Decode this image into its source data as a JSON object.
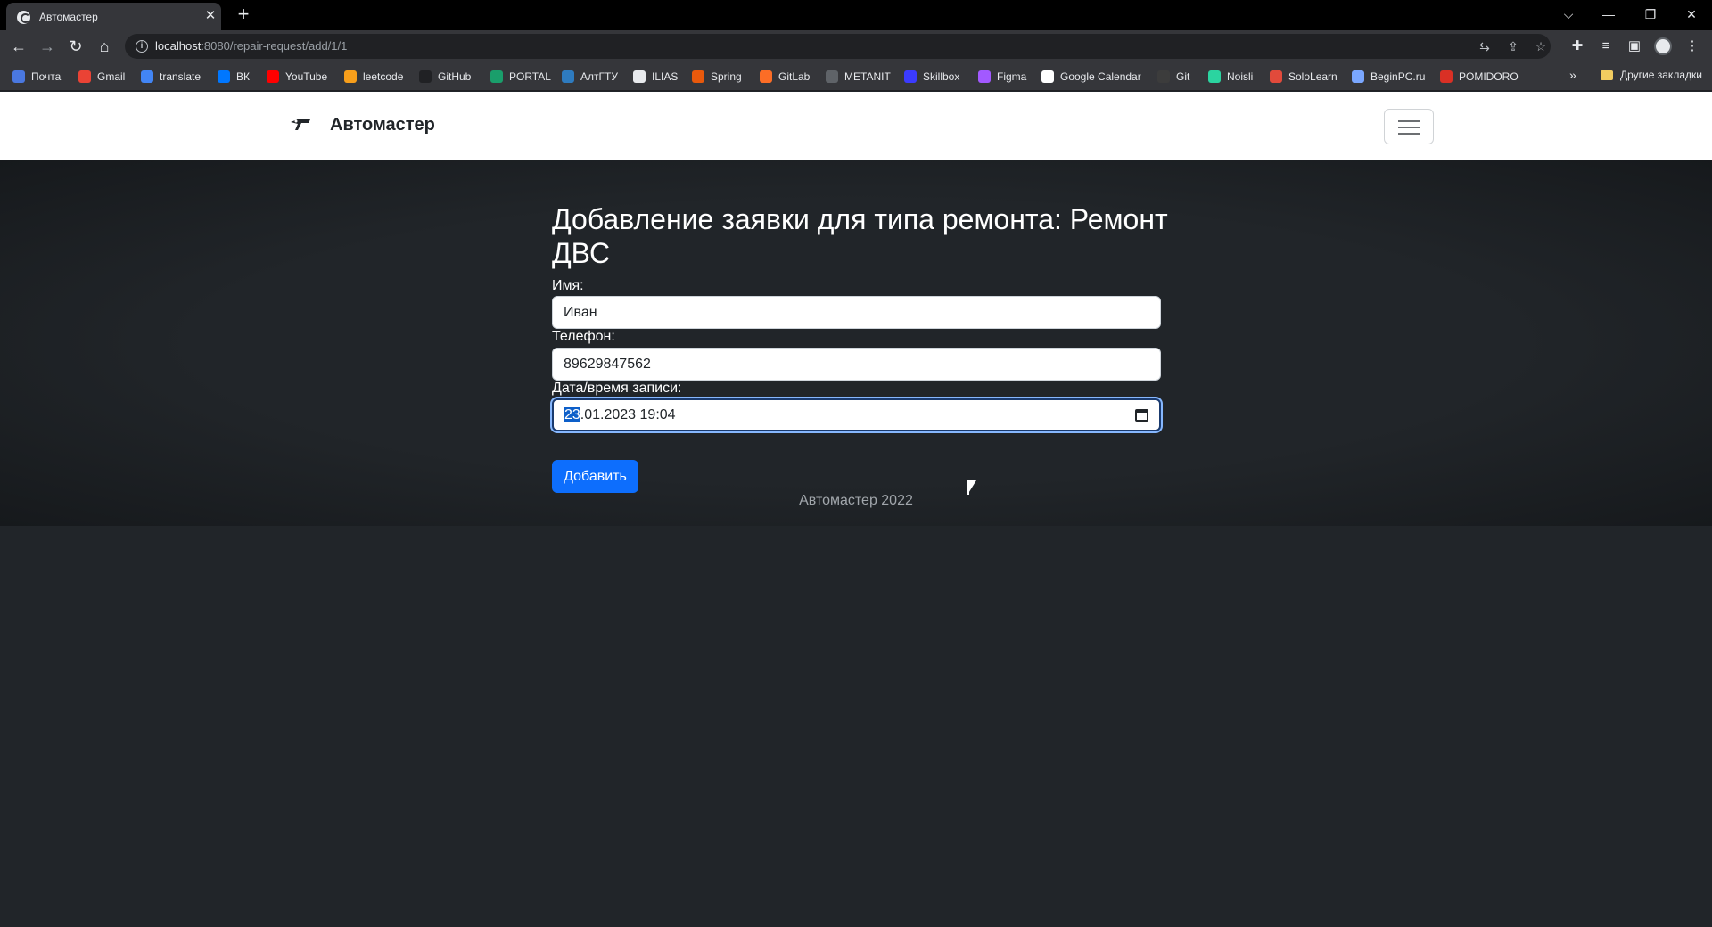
{
  "browser": {
    "tab_title": "Автомастер",
    "tab_close": "✕",
    "new_tab": "+",
    "url_host": "localhost",
    "url_path": ":8080/repair-request/add/1/1",
    "window_controls": {
      "chevron": "⌵",
      "minimize": "—",
      "restore": "❐",
      "close": "✕"
    },
    "nav": {
      "back": "←",
      "forward": "→",
      "reload": "↻",
      "home": "⌂"
    },
    "omnibox_icons": [
      "translate-icon",
      "share-icon",
      "star-icon"
    ],
    "toolbar_icons": [
      "extensions-icon",
      "media-icon",
      "sidebar-icon",
      "profile-avatar",
      "menu-icon"
    ]
  },
  "bookmarks": {
    "items": [
      {
        "label": "Почта",
        "icon": "mail-icon",
        "color": "#4a78e0"
      },
      {
        "label": "Gmail",
        "icon": "gmail-icon",
        "color": "#ea4335"
      },
      {
        "label": "translate",
        "icon": "translate-icon",
        "color": "#4285f4"
      },
      {
        "label": "ВК",
        "icon": "vk-icon",
        "color": "#0077ff"
      },
      {
        "label": "YouTube",
        "icon": "youtube-icon",
        "color": "#ff0000"
      },
      {
        "label": "leetcode",
        "icon": "leetcode-icon",
        "color": "#f89f1b"
      },
      {
        "label": "GitHub",
        "icon": "github-icon",
        "color": "#202124"
      },
      {
        "label": "PORTAL",
        "icon": "portal-icon",
        "color": "#1a9e6b"
      },
      {
        "label": "АлтГТУ",
        "icon": "altgtu-icon",
        "color": "#2e7bbf"
      },
      {
        "label": "ILIAS",
        "icon": "ilias-icon",
        "color": "#e8eaed"
      },
      {
        "label": "Spring",
        "icon": "spring-icon",
        "color": "#e8590c"
      },
      {
        "label": "GitLab",
        "icon": "gitlab-icon",
        "color": "#fc6d26"
      },
      {
        "label": "METANIT",
        "icon": "metanit-icon",
        "color": "#5f6368"
      },
      {
        "label": "Skillbox",
        "icon": "skillbox-icon",
        "color": "#3b3bff"
      },
      {
        "label": "Figma",
        "icon": "figma-icon",
        "color": "#a259ff"
      },
      {
        "label": "Google Calendar",
        "icon": "google-icon",
        "color": "#ffffff"
      },
      {
        "label": "Git",
        "icon": "git-icon",
        "color": "#3c3c3c"
      },
      {
        "label": "Noisli",
        "icon": "noisli-icon",
        "color": "#2bd4a0"
      },
      {
        "label": "SoloLearn",
        "icon": "sololearn-icon",
        "color": "#e14a3b"
      },
      {
        "label": "BeginPC.ru",
        "icon": "beginpc-icon",
        "color": "#7aa7ff"
      },
      {
        "label": "POMIDORO",
        "icon": "pomidoro-icon",
        "color": "#d93025"
      }
    ],
    "more": "»",
    "other": "Другие закладки"
  },
  "navbar": {
    "brand": "Автомастер",
    "logo_icon": "car-logo-icon",
    "toggler_icon": "hamburger-icon"
  },
  "form": {
    "title": "Добавление заявки для типа ремонта: Ремонт ДВС",
    "name_label": "Имя:",
    "name_value": "Иван",
    "phone_label": "Телефон:",
    "phone_value": "89629847562",
    "datetime_label": "Дата/время записи:",
    "datetime_selected": "23",
    "datetime_rest": ".01.2023 19:04",
    "submit_label": "Добавить"
  },
  "footer": {
    "text": "Автомастер 2022"
  },
  "colors": {
    "page_bg": "#212529",
    "primary": "#0d6efd",
    "navbar_bg": "#ffffff"
  }
}
